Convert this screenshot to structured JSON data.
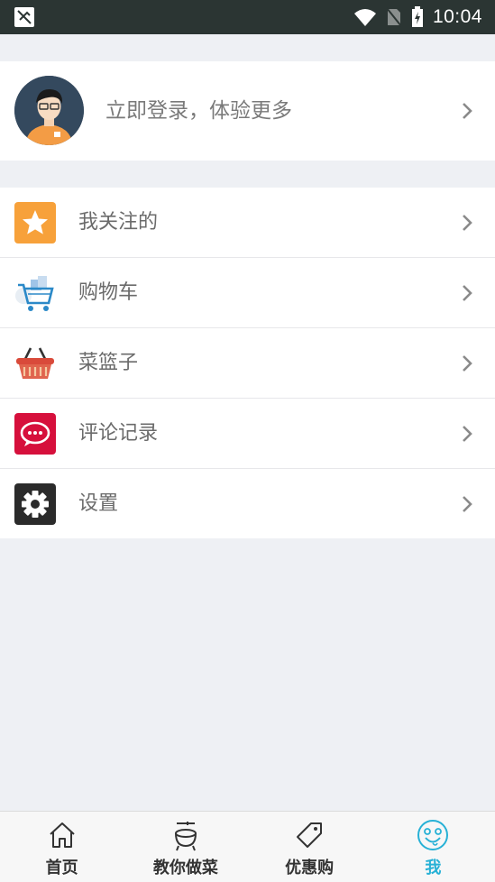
{
  "status_bar": {
    "time": "10:04"
  },
  "profile": {
    "login_text": "立即登录，体验更多"
  },
  "menu": {
    "items": [
      {
        "label": "我关注的",
        "icon": "star-icon"
      },
      {
        "label": "购物车",
        "icon": "shopping-cart-icon"
      },
      {
        "label": "菜篮子",
        "icon": "basket-icon"
      },
      {
        "label": "评论记录",
        "icon": "comment-icon"
      },
      {
        "label": "设置",
        "icon": "gear-icon"
      }
    ]
  },
  "tabbar": {
    "tabs": [
      {
        "label": "首页",
        "icon": "home-icon"
      },
      {
        "label": "教你做菜",
        "icon": "cooking-pot-icon"
      },
      {
        "label": "优惠购",
        "icon": "tag-icon"
      },
      {
        "label": "我",
        "icon": "smiley-icon",
        "active": true
      }
    ]
  },
  "colors": {
    "accent": "#27b1d6",
    "status_bar": "#2b3533"
  }
}
